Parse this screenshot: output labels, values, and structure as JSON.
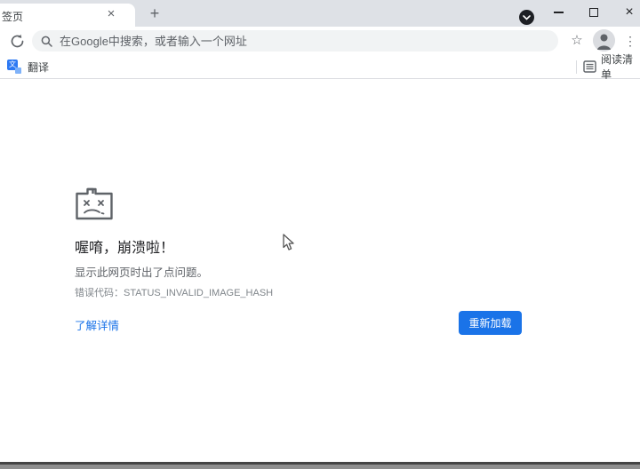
{
  "titlebar": {
    "tab_title": "签页",
    "tab_close_glyph": "×",
    "new_tab_glyph": "+",
    "window_close_glyph": "×"
  },
  "toolbar": {
    "omnibox_placeholder": "在Google中搜索，或者输入一个网址",
    "star_glyph": "☆",
    "menu_glyph": "⋮"
  },
  "bookmarks_bar": {
    "translate_label": "翻译",
    "translate_favicon_glyph": "文",
    "reading_list_label": "阅读清单"
  },
  "crash_page": {
    "title": "喔唷，崩溃啦！",
    "subtitle": "显示此网页时出了点问题。",
    "error_code_line": "错误代码：STATUS_INVALID_IMAGE_HASH",
    "learn_more_label": "了解详情",
    "reload_button_label": "重新加载"
  },
  "colors": {
    "accent_blue": "#1a73e8",
    "tab_strip_gray": "#dee1e6",
    "icon_gray": "#5f6368",
    "omnibox_gray": "#f1f3f4"
  }
}
